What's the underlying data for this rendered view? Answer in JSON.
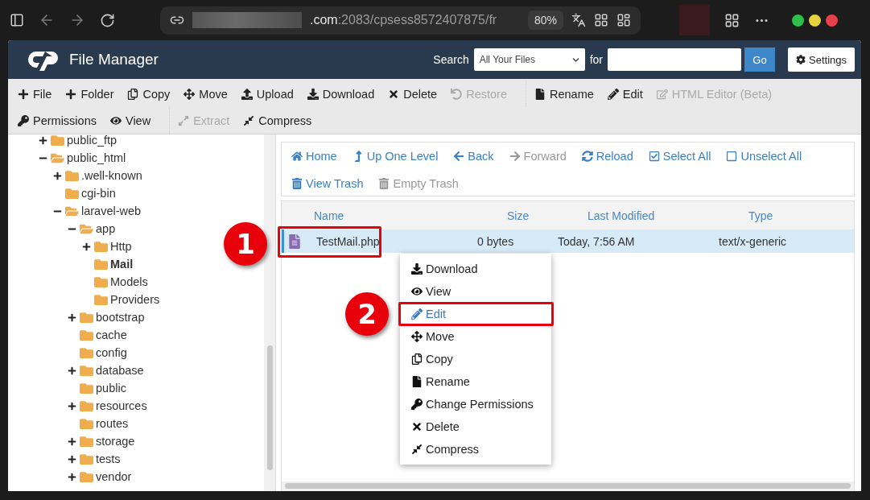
{
  "browser": {
    "url_host": ".com",
    "url_rest": ":2083/cpsess8572407875/fr",
    "zoom": "80%"
  },
  "header": {
    "title": "File Manager",
    "search_label": "Search",
    "search_scope": "All Your Files",
    "for_label": "for",
    "go": "Go",
    "settings": "Settings"
  },
  "toolbar_rows": [
    [
      [
        {
          "label": "File",
          "disabled": false
        },
        {
          "label": "Folder",
          "disabled": false
        },
        {
          "label": "Copy",
          "disabled": false
        },
        {
          "label": "Move",
          "disabled": false
        },
        {
          "label": "Upload",
          "disabled": false
        },
        {
          "label": "Download",
          "disabled": false
        },
        {
          "label": "Delete",
          "disabled": false
        },
        {
          "label": "Restore",
          "disabled": true
        }
      ],
      [
        {
          "label": "Rename",
          "disabled": false
        },
        {
          "label": "Edit",
          "disabled": false
        },
        {
          "label": "HTML Editor (Beta)",
          "disabled": true
        }
      ]
    ],
    [
      [
        {
          "label": "Permissions",
          "disabled": false
        },
        {
          "label": "View",
          "disabled": false
        }
      ],
      [
        {
          "label": "Extract",
          "disabled": true
        },
        {
          "label": "Compress",
          "disabled": false
        }
      ]
    ]
  ],
  "tree": [
    {
      "label": "public_ftp",
      "has_children": true,
      "expanded": false,
      "selected": false
    },
    {
      "label": "public_html",
      "has_children": true,
      "expanded": true,
      "selected": false,
      "children": [
        {
          "label": ".well-known",
          "has_children": true,
          "expanded": false,
          "selected": false
        },
        {
          "label": "cgi-bin",
          "has_children": false,
          "expanded": false,
          "selected": false
        },
        {
          "label": "laravel-web",
          "has_children": true,
          "expanded": true,
          "selected": false,
          "children": [
            {
              "label": "app",
              "has_children": true,
              "expanded": true,
              "selected": false,
              "children": [
                {
                  "label": "Http",
                  "has_children": true,
                  "expanded": false,
                  "selected": false
                },
                {
                  "label": "Mail",
                  "has_children": false,
                  "expanded": false,
                  "selected": true
                },
                {
                  "label": "Models",
                  "has_children": false,
                  "expanded": false,
                  "selected": false
                },
                {
                  "label": "Providers",
                  "has_children": false,
                  "expanded": false,
                  "selected": false
                }
              ]
            },
            {
              "label": "bootstrap",
              "has_children": true,
              "expanded": false,
              "selected": false
            },
            {
              "label": "cache",
              "has_children": false,
              "expanded": false,
              "selected": false
            },
            {
              "label": "config",
              "has_children": false,
              "expanded": false,
              "selected": false
            },
            {
              "label": "database",
              "has_children": true,
              "expanded": false,
              "selected": false
            },
            {
              "label": "public",
              "has_children": false,
              "expanded": false,
              "selected": false
            },
            {
              "label": "resources",
              "has_children": true,
              "expanded": false,
              "selected": false
            },
            {
              "label": "routes",
              "has_children": false,
              "expanded": false,
              "selected": false
            },
            {
              "label": "storage",
              "has_children": true,
              "expanded": false,
              "selected": false
            },
            {
              "label": "tests",
              "has_children": true,
              "expanded": false,
              "selected": false
            },
            {
              "label": "vendor",
              "has_children": true,
              "expanded": false,
              "selected": false
            }
          ]
        }
      ]
    }
  ],
  "nav": [
    {
      "label": "Home",
      "disabled": false
    },
    {
      "label": "Up One Level",
      "disabled": false
    },
    {
      "label": "Back",
      "disabled": false
    },
    {
      "label": "Forward",
      "disabled": true
    },
    {
      "label": "Reload",
      "disabled": false
    },
    {
      "label": "Select All",
      "disabled": false
    },
    {
      "label": "Unselect All",
      "disabled": false
    },
    {
      "label": "View Trash",
      "disabled": false
    },
    {
      "label": "Empty Trash",
      "disabled": true
    }
  ],
  "table": {
    "columns": [
      "Name",
      "Size",
      "Last Modified",
      "Type"
    ],
    "rows": [
      {
        "name": "TestMail.php",
        "size": "0 bytes",
        "modified": "Today, 7:56 AM",
        "type": "text/x-generic",
        "selected": true
      }
    ]
  },
  "context_menu": [
    {
      "label": "Download",
      "selected": false
    },
    {
      "label": "View",
      "selected": false
    },
    {
      "label": "Edit",
      "selected": true
    },
    {
      "label": "Move",
      "selected": false
    },
    {
      "label": "Copy",
      "selected": false
    },
    {
      "label": "Rename",
      "selected": false
    },
    {
      "label": "Change Permissions",
      "selected": false
    },
    {
      "label": "Delete",
      "selected": false
    },
    {
      "label": "Compress",
      "selected": false
    }
  ],
  "annotations": [
    {
      "label": "1"
    },
    {
      "label": "2"
    }
  ]
}
